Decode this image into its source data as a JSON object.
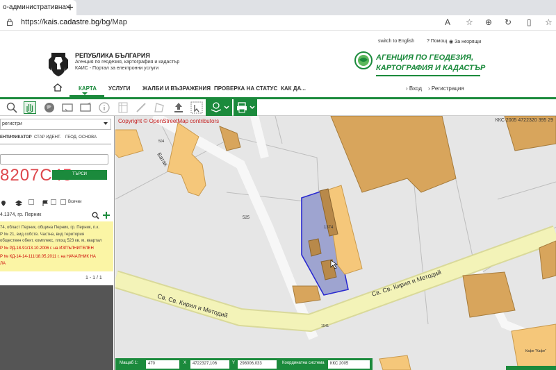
{
  "browser": {
    "tab_title": "о-административна",
    "tab_close": "×",
    "new_tab": "+",
    "url_prefix": "https://",
    "url_host": "kais.cadastre.bg",
    "url_path": "/bg/Map"
  },
  "header": {
    "switch_lang": "switch to English",
    "help": "Помощ",
    "impaired": "За незрящи",
    "republic": "РЕПУБЛИКА БЪЛГАРИЯ",
    "agency_line": "Агенция по геодезия, картография и кадастър",
    "portal_line": "КАИС - Портал за електронни услуги",
    "logo_line1": "АГЕНЦИЯ ПО ГЕОДЕЗИЯ,",
    "logo_line2": "КАРТОГРАФИЯ И КАДАСТЪР"
  },
  "nav": {
    "items": [
      "КАРТА",
      "УСЛУГИ",
      "ЖАЛБИ И ВЪЗРАЖЕНИЯ",
      "ПРОВЕРКА НА СТАТУС",
      "КАК ДА..."
    ],
    "login": "Вход",
    "register": "Регистрация"
  },
  "panel": {
    "select_value": "регистри",
    "tabs": [
      "ЕНТИФИКАТОР",
      "СТАР ИДЕНТ.",
      "ГЕОД. ОСНОВА"
    ],
    "number": "8207С45",
    "search_button": "ТЪРСИ",
    "all_label": "Всички",
    "result_text": "4.1374, гр. Перник",
    "info_lines": [
      "74, област Перник, община Перник, гр. Перник, п.к.",
      "Р № 21, вид собств. Частна, вид територия",
      "обществен обект, комплекс, площ 523 кв. м, квартал"
    ],
    "order1": "Р № РД-18-91/13.10.2006 г. на ИЗПЪЛНИТЕЛЕН",
    "order2": "Р № КД-14-14-111/18.05.2011 г. на НАЧАЛНИК НА",
    "order2_tail": "ЛА",
    "pager": "1 - 1 / 1"
  },
  "map": {
    "copyright": "Copyright © OpenStreetMap contributors",
    "coord_system_top": "ККС 2005 4722320 395 29",
    "street1": "Св. Св. Кирил и Методий",
    "street2": "Св. Св. Кирил и Методий",
    "street3": "Батак",
    "parcel_main": "1374",
    "parcel_525": "525",
    "parcel_504": "504",
    "parcel_1541": "1541",
    "shop_label": "Кафе \"Кафе\""
  },
  "status": {
    "scale_label": "Мащаб 1:",
    "scale_value": "470",
    "x_label": "X",
    "x_value": "4722327,106",
    "y_label": "Y",
    "y_value": "298006,033",
    "coord_label": "Координатна система",
    "coord_value": "ККС 2005"
  },
  "colors": {
    "brand_green": "#1b8a3c",
    "building": "#f5c77a",
    "building_dark": "#d8a55c",
    "parcel_select": "#9ea4d0",
    "road": "#f3f3b8"
  }
}
